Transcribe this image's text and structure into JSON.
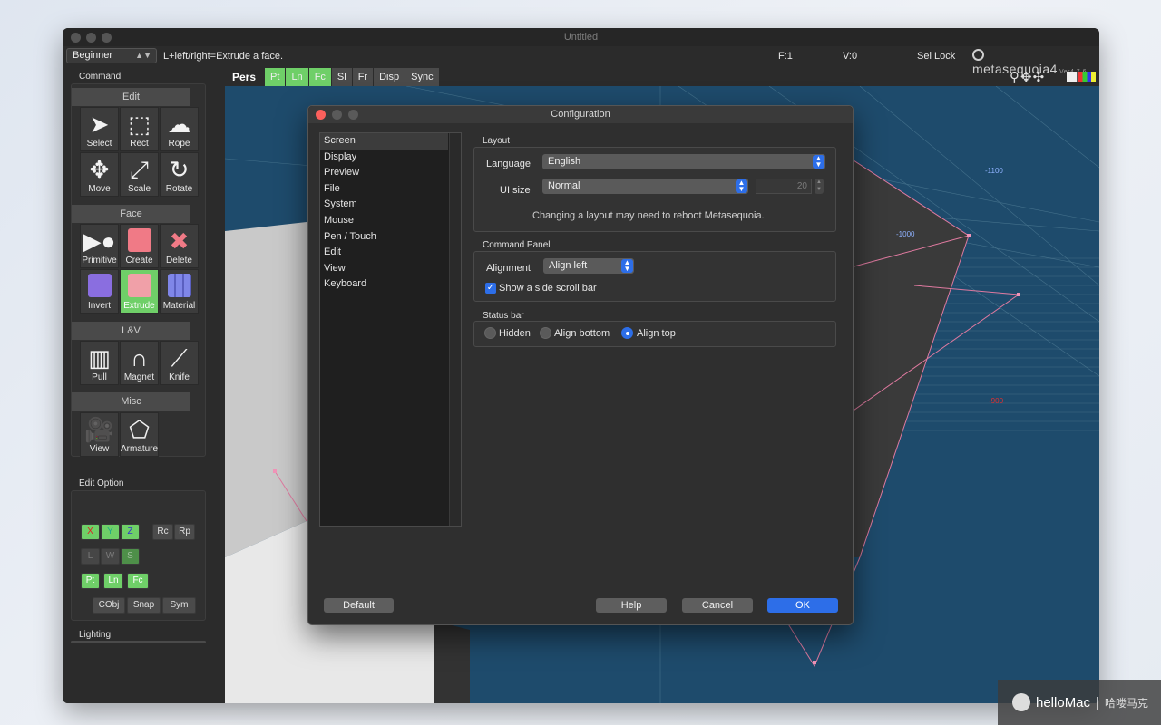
{
  "window": {
    "title": "Untitled"
  },
  "toolbar": {
    "mode": "Beginner",
    "hint": "L+left/right=Extrude a face.",
    "face_count": "F:1",
    "vertex_count": "V:0",
    "sel_lock": "Sel Lock",
    "brand": "metasequoia4",
    "version": "Ver4.7.6"
  },
  "command_panel": {
    "label": "Command",
    "groups": [
      {
        "title": "Edit",
        "tools": [
          "Select",
          "Rect",
          "Rope",
          "Move",
          "Scale",
          "Rotate"
        ]
      },
      {
        "title": "Face",
        "tools": [
          "Primitive",
          "Create",
          "Delete",
          "Invert",
          "Extrude",
          "Material"
        ]
      },
      {
        "title": "L&V",
        "tools": [
          "Pull",
          "Magnet",
          "Knife"
        ]
      },
      {
        "title": "Misc",
        "tools": [
          "View",
          "Armature"
        ]
      }
    ],
    "active_tool": "Extrude"
  },
  "edit_option": {
    "label": "Edit Option",
    "axes": [
      "X",
      "Y",
      "Z"
    ],
    "rc": "Rc",
    "rp": "Rp",
    "lws": [
      "L",
      "W",
      "S"
    ],
    "plf": [
      "Pt",
      "Ln",
      "Fc"
    ],
    "cobj": "CObj",
    "snap": "Snap",
    "sym": "Sym"
  },
  "lighting": {
    "label": "Lighting"
  },
  "view_tabs": {
    "pers": "Pers",
    "tabs": [
      "Pt",
      "Ln",
      "Fc",
      "Sl",
      "Fr",
      "Disp",
      "Sync"
    ]
  },
  "viewport": {
    "label_1100": "-1100",
    "label_1000": "-1000",
    "label_900": "-900"
  },
  "dialog": {
    "title": "Configuration",
    "categories": [
      "Screen",
      "Display",
      "Preview",
      "File",
      "System",
      "Mouse",
      "Pen / Touch",
      "Edit",
      "View",
      "Keyboard"
    ],
    "selected_category": "Screen",
    "layout": {
      "section": "Layout",
      "language_label": "Language",
      "language_value": "English",
      "ui_size_label": "UI size",
      "ui_size_value": "Normal",
      "ui_size_number": "20",
      "note": "Changing a layout may need to reboot Metasequoia."
    },
    "command_panel": {
      "section": "Command Panel",
      "alignment_label": "Alignment",
      "alignment_value": "Align left",
      "scrollbar_label": "Show a side scroll bar",
      "scrollbar_checked": true
    },
    "status_bar": {
      "section": "Status bar",
      "options": [
        "Hidden",
        "Align bottom",
        "Align top"
      ],
      "selected": "Align top"
    },
    "buttons": {
      "default": "Default",
      "help": "Help",
      "cancel": "Cancel",
      "ok": "OK"
    }
  },
  "watermark": {
    "brand": "helloMac",
    "sub": "哈喽马克"
  }
}
